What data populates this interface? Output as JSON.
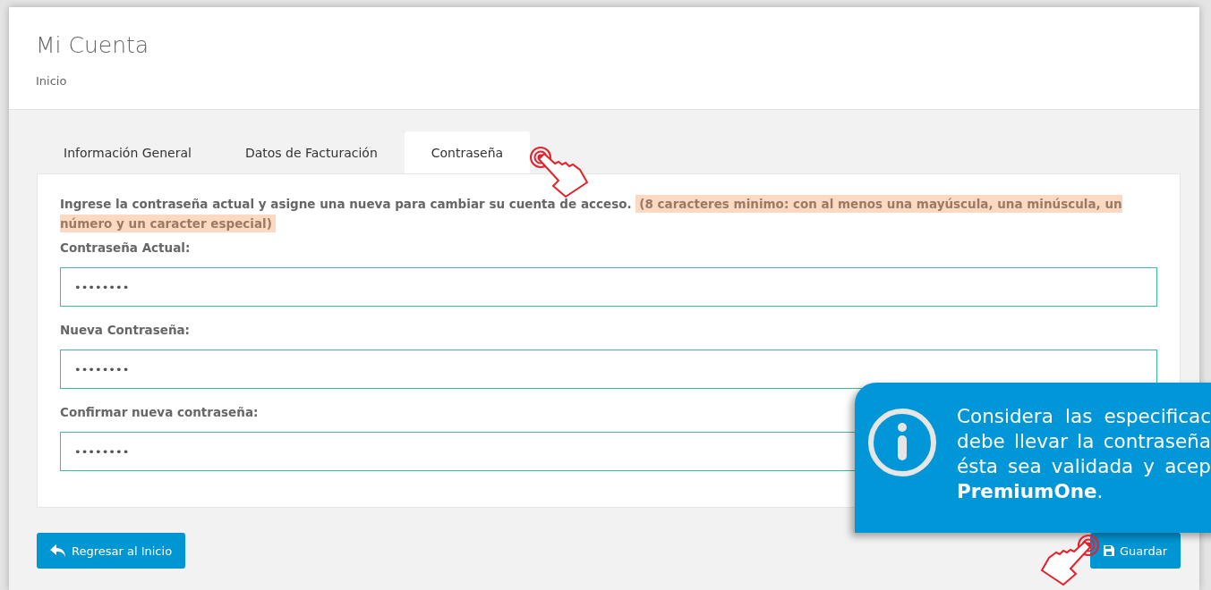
{
  "header": {
    "title": "Mi Cuenta",
    "breadcrumb": "Inicio"
  },
  "tabs": [
    {
      "label": "Información General",
      "selected": false
    },
    {
      "label": "Datos de Facturación",
      "selected": false
    },
    {
      "label": "Contraseña",
      "selected": true
    }
  ],
  "form": {
    "instruction": "Ingrese la contraseña actual y asigne una nueva para cambiar su cuenta de acceso.",
    "requirements": "(8 caracteres minimo: con al menos una mayúscula, una minúscula, un número y un caracter especial)",
    "fields": [
      {
        "label": "Contraseña Actual:",
        "value": "••••••••"
      },
      {
        "label": "Nueva Contraseña:",
        "value": "••••••••"
      },
      {
        "label": "Confirmar nueva contraseña:",
        "value": "••••••••"
      }
    ]
  },
  "buttons": {
    "back": "Regresar al Inicio",
    "save": "Guardar"
  },
  "callout": {
    "lines": [
      "Considera las especificac",
      "debe llevar la contraseña",
      "ésta sea validada y acep",
      "**PremiumOne**."
    ]
  }
}
